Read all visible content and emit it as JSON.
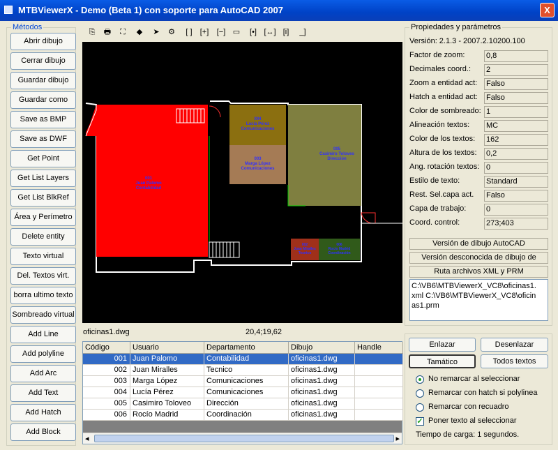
{
  "window": {
    "title": "MTBViewerX - Demo (Beta 1) con soporte para AutoCAD 2007",
    "close_glyph": "X"
  },
  "metodos": {
    "title": "Métodos",
    "buttons": [
      "Abrir dibujo",
      "Cerrar dibujo",
      "Guardar dibujo",
      "Guardar como",
      "Save as BMP",
      "Save as DWF",
      "Get Point",
      "Get List Layers",
      "Get List BlkRef",
      "Área y Perímetro",
      "Delete entity",
      "Texto virtual",
      "Del. Textos virt.",
      "borra ultimo texto",
      "Sombreado virtual",
      "Add Line",
      "Add polyline",
      "Add Arc",
      "Add Text",
      "Add Hatch",
      "Add Block"
    ]
  },
  "toolbar": {
    "icons": [
      "copy-icon",
      "print-icon",
      "zoom-extents-icon",
      "layers-icon",
      "pointer-icon",
      "properties-icon",
      "bracket-icon",
      "zoom-in-icon",
      "zoom-out-icon",
      "window-icon",
      "fit-width-icon",
      "pan-icon",
      "info-icon",
      "baseline-icon"
    ],
    "glyphs": [
      "⎘",
      "🖶",
      "⛶",
      "◆",
      "➤",
      "⚙",
      "[ ]",
      "[+]",
      "[−]",
      "▭",
      "[•]",
      "[↔]",
      "[i]",
      "_]"
    ]
  },
  "drawing": {
    "rooms": [
      {
        "id": "001",
        "name": "Juan Palomo",
        "dept": "Contabilidad"
      },
      {
        "id": "004",
        "name": "Lucía Pérez",
        "dept": "Comunicaciones"
      },
      {
        "id": "003",
        "name": "Marga López",
        "dept": "Comunicaciones"
      },
      {
        "id": "005",
        "name": "Casimiro Toloveo",
        "dept": "Dirección"
      },
      {
        "id": "002",
        "name": "Juan Miralles",
        "dept": "Tecnico"
      },
      {
        "id": "006",
        "name": "Rocío Madrid",
        "dept": "Coordinación"
      }
    ],
    "colors": {
      "red": "#ff0000",
      "brown1": "#8b6f10",
      "brown2": "#a57b55",
      "olive": "#7f7f40",
      "darkred": "#a0301a",
      "darkgreen": "#305a1a"
    }
  },
  "status": {
    "filename": "oficinas1.dwg",
    "coords": "20,4;19,62"
  },
  "table": {
    "columns": [
      "Código",
      "Usuario",
      "Departamento",
      "Dibujo",
      "Handle"
    ],
    "rows": [
      [
        "001",
        "Juan Palomo",
        "Contabilidad",
        "oficinas1.dwg",
        ""
      ],
      [
        "002",
        "Juan Miralles",
        "Tecnico",
        "oficinas1.dwg",
        ""
      ],
      [
        "003",
        "Marga López",
        "Comunicaciones",
        "oficinas1.dwg",
        ""
      ],
      [
        "004",
        "Lucía Pérez",
        "Comunicaciones",
        "oficinas1.dwg",
        ""
      ],
      [
        "005",
        "Casimiro Toloveo",
        "Dirección",
        "oficinas1.dwg",
        ""
      ],
      [
        "006",
        "Rocío Madrid",
        "Coordinación",
        "oficinas1.dwg",
        ""
      ]
    ],
    "selected_row": 0,
    "scroll_left": "◂",
    "scroll_right": "▸"
  },
  "props": {
    "title": "Propiedades y parámetros",
    "version": "Versión: 2.1.3 - 2007.2.10200.100",
    "items": [
      {
        "label": "Factor de zoom:",
        "value": "0,8"
      },
      {
        "label": "Decimales coord.:",
        "value": "2"
      },
      {
        "label": "Zoom a entidad act:",
        "value": "Falso"
      },
      {
        "label": "Hatch a entidad act:",
        "value": "Falso"
      },
      {
        "label": "Color de sombreado:",
        "value": "1"
      },
      {
        "label": "Alineación textos:",
        "value": "MC"
      },
      {
        "label": "Color de los textos:",
        "value": "162"
      },
      {
        "label": "Altura de los textos:",
        "value": "0,2"
      },
      {
        "label": "Ang. rotación textos:",
        "value": "0"
      },
      {
        "label": "Estilo de texto:",
        "value": "Standard"
      },
      {
        "label": "Rest. Sel.capa act.",
        "value": "Falso"
      },
      {
        "label": "Capa de trabajo:",
        "value": "0"
      },
      {
        "label": "Coord. control:",
        "value": "273;403"
      }
    ],
    "autocad_version_label": "Versión de dibujo AutoCAD",
    "autocad_version_value": "Versión desconocida de dibujo de",
    "paths_label": "Ruta archivos XML y PRM",
    "paths_text": "C:\\VB6\\MTBViewerX_VC8\\oficinas1.xml C:\\VB6\\MTBViewerX_VC8\\oficinas1.prm"
  },
  "controls": {
    "enlazar": "Enlazar",
    "desenlazar": "Desenlazar",
    "tamatico": "Tamático",
    "todos": "Todos textos",
    "options": [
      {
        "label": "No remarcar al seleccionar",
        "checked": true
      },
      {
        "label": "Remarcar con hatch si polylinea",
        "checked": false
      },
      {
        "label": "Remarcar con recuadro",
        "checked": false
      }
    ],
    "checkbox": {
      "label": "Poner texto al seleccionar",
      "checked": true
    },
    "load_time": "Tiempo de carga:  1 segundos."
  }
}
